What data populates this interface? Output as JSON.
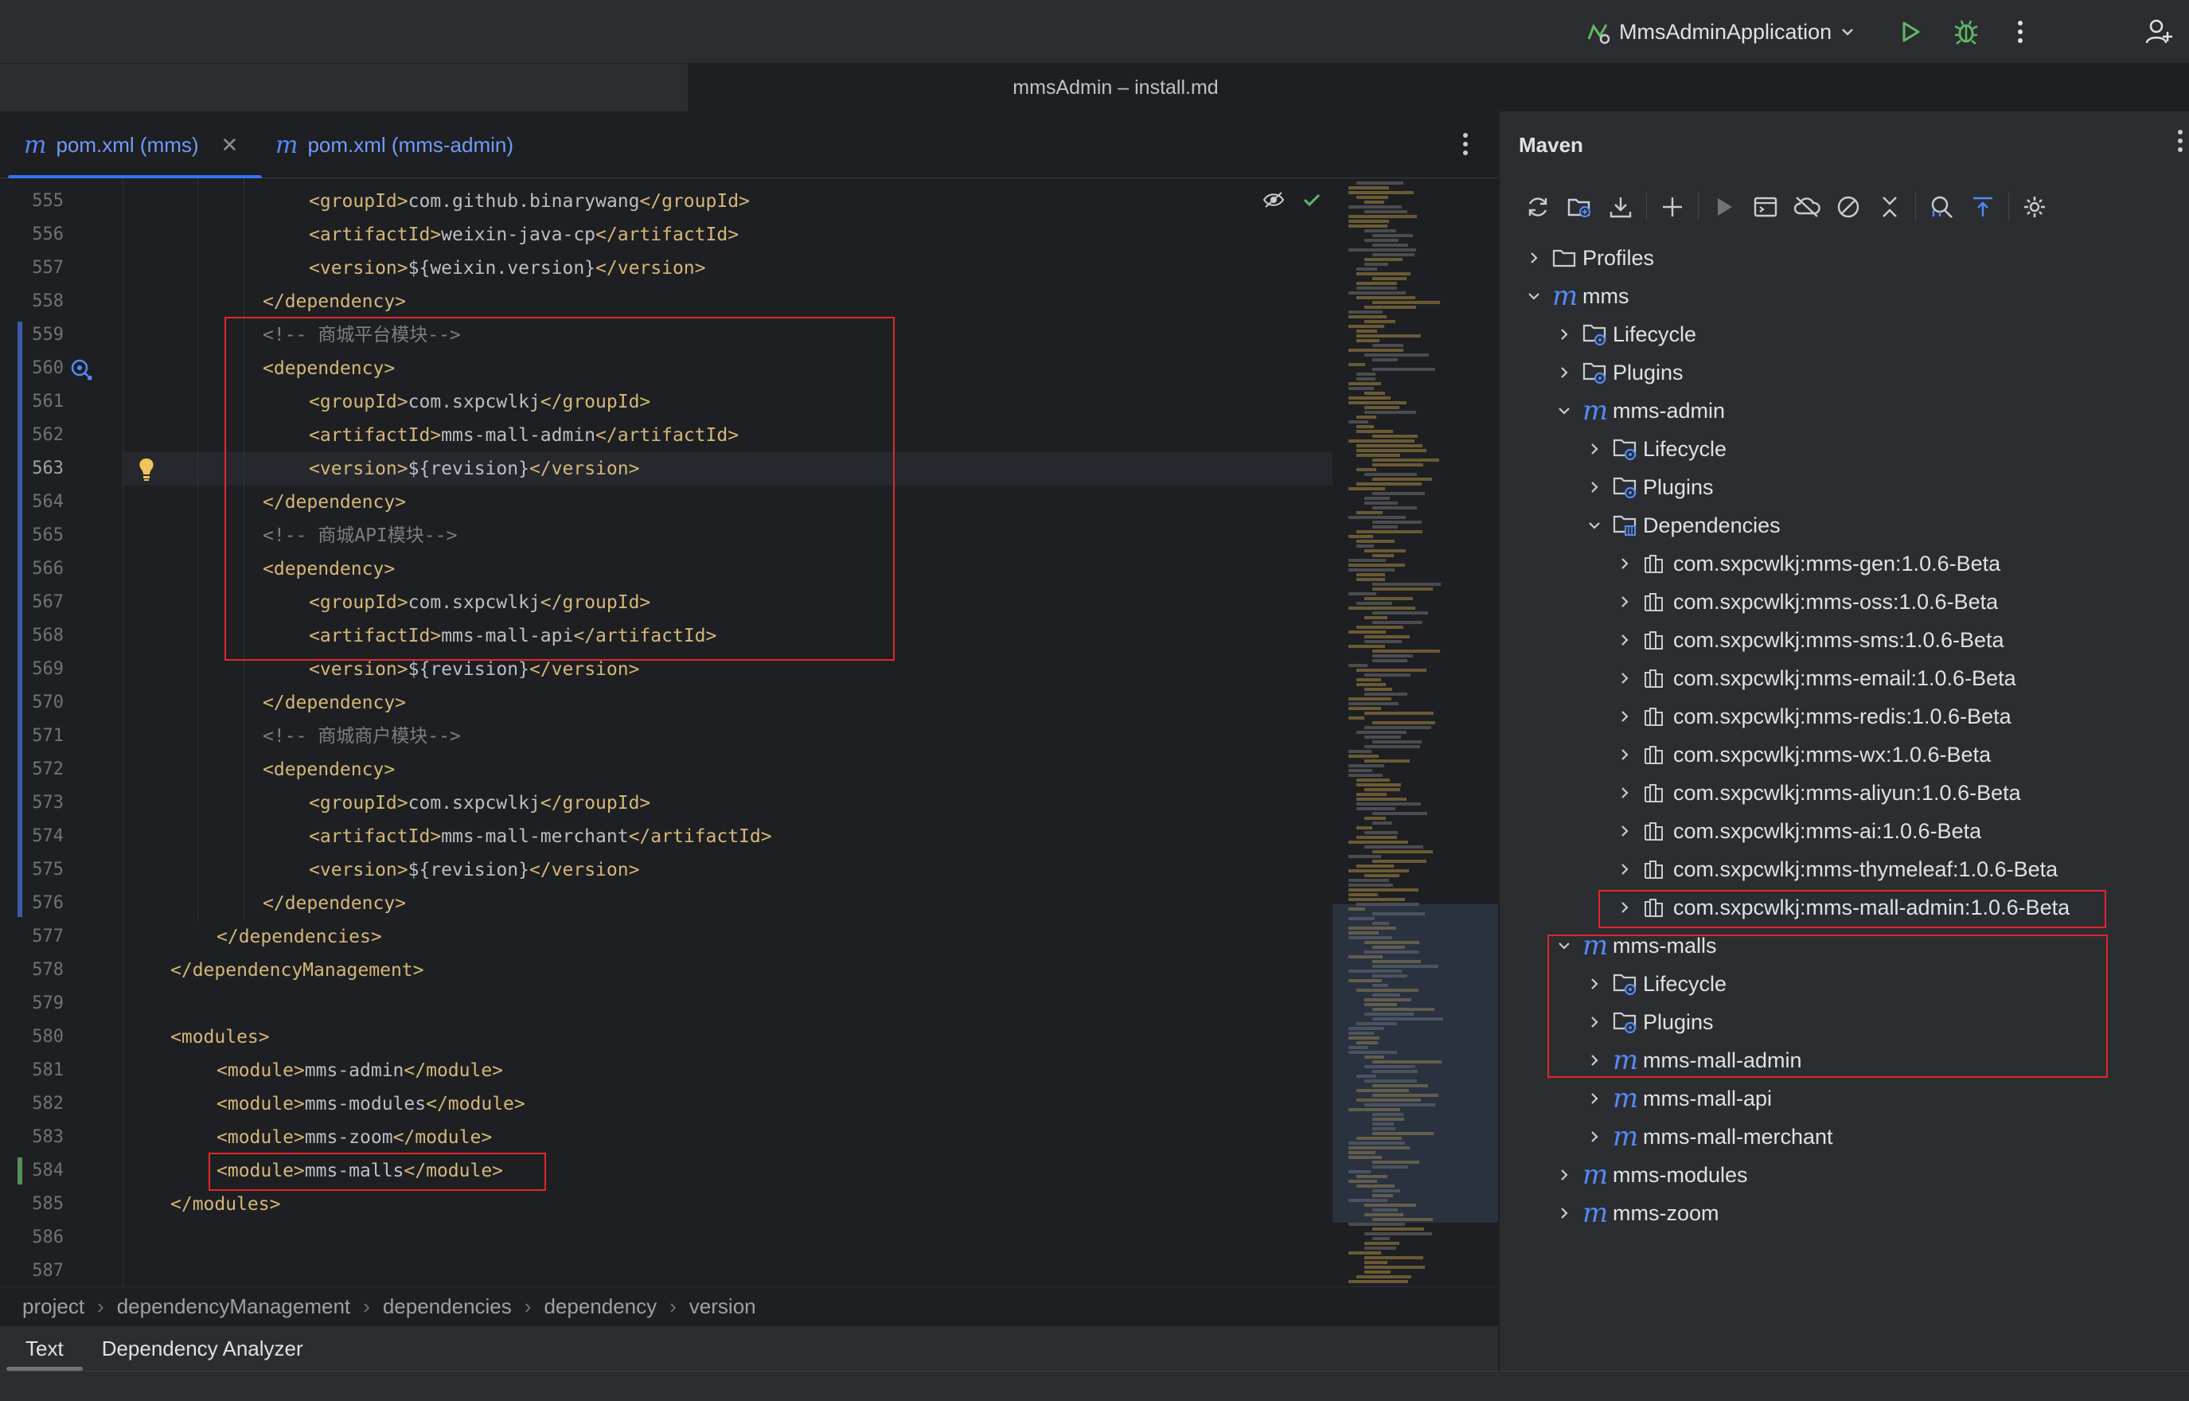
{
  "toolbar": {
    "run_config": "MmsAdminApplication",
    "icons": [
      "run-config-icon",
      "chevron-down-icon",
      "run-icon",
      "debug-icon",
      "more-vertical-icon",
      "add-user-icon"
    ]
  },
  "window_title": "mmsAdmin – install.md",
  "editor_tabs": [
    {
      "label": "pom.xml (mms)",
      "active": true,
      "closable": true
    },
    {
      "label": "pom.xml (mms-admin)",
      "active": false,
      "closable": false
    }
  ],
  "editor": {
    "current_line": 563,
    "lines": [
      {
        "n": 555,
        "indent": 3,
        "parts": [
          [
            "tag",
            "<groupId>"
          ],
          [
            "txt",
            "com.github.binarywang"
          ],
          [
            "tag",
            "</groupId>"
          ]
        ]
      },
      {
        "n": 556,
        "indent": 3,
        "parts": [
          [
            "tag",
            "<artifactId>"
          ],
          [
            "txt",
            "weixin-java-cp"
          ],
          [
            "tag",
            "</artifactId>"
          ]
        ]
      },
      {
        "n": 557,
        "indent": 3,
        "parts": [
          [
            "tag",
            "<version>"
          ],
          [
            "txt",
            "${weixin.version}"
          ],
          [
            "tag",
            "</version>"
          ]
        ]
      },
      {
        "n": 558,
        "indent": 2,
        "parts": [
          [
            "tag",
            "</dependency>"
          ]
        ]
      },
      {
        "n": 559,
        "indent": 2,
        "parts": [
          [
            "cmt",
            "<!-- 商城平台模块-->"
          ]
        ]
      },
      {
        "n": 560,
        "indent": 2,
        "parts": [
          [
            "tag",
            "<dependency>"
          ]
        ]
      },
      {
        "n": 561,
        "indent": 3,
        "parts": [
          [
            "tag",
            "<groupId>"
          ],
          [
            "txt",
            "com.sxpcwlkj"
          ],
          [
            "tag",
            "</groupId>"
          ]
        ]
      },
      {
        "n": 562,
        "indent": 3,
        "parts": [
          [
            "tag",
            "<artifactId>"
          ],
          [
            "txt",
            "mms-mall-admin"
          ],
          [
            "tag",
            "</artifactId>"
          ]
        ]
      },
      {
        "n": 563,
        "indent": 3,
        "parts": [
          [
            "tag",
            "<version>"
          ],
          [
            "txt",
            "${revision}"
          ],
          [
            "tag",
            "</version>"
          ]
        ]
      },
      {
        "n": 564,
        "indent": 2,
        "parts": [
          [
            "tag",
            "</dependency>"
          ]
        ]
      },
      {
        "n": 565,
        "indent": 2,
        "parts": [
          [
            "cmt",
            "<!-- 商城API模块-->"
          ]
        ]
      },
      {
        "n": 566,
        "indent": 2,
        "parts": [
          [
            "tag",
            "<dependency>"
          ]
        ]
      },
      {
        "n": 567,
        "indent": 3,
        "parts": [
          [
            "tag",
            "<groupId>"
          ],
          [
            "txt",
            "com.sxpcwlkj"
          ],
          [
            "tag",
            "</groupId>"
          ]
        ]
      },
      {
        "n": 568,
        "indent": 3,
        "parts": [
          [
            "tag",
            "<artifactId>"
          ],
          [
            "txt",
            "mms-mall-api"
          ],
          [
            "tag",
            "</artifactId>"
          ]
        ]
      },
      {
        "n": 569,
        "indent": 3,
        "parts": [
          [
            "tag",
            "<version>"
          ],
          [
            "txt",
            "${revision}"
          ],
          [
            "tag",
            "</version>"
          ]
        ]
      },
      {
        "n": 570,
        "indent": 2,
        "parts": [
          [
            "tag",
            "</dependency>"
          ]
        ]
      },
      {
        "n": 571,
        "indent": 2,
        "parts": [
          [
            "cmt",
            "<!-- 商城商户模块-->"
          ]
        ]
      },
      {
        "n": 572,
        "indent": 2,
        "parts": [
          [
            "tag",
            "<dependency>"
          ]
        ]
      },
      {
        "n": 573,
        "indent": 3,
        "parts": [
          [
            "tag",
            "<groupId>"
          ],
          [
            "txt",
            "com.sxpcwlkj"
          ],
          [
            "tag",
            "</groupId>"
          ]
        ]
      },
      {
        "n": 574,
        "indent": 3,
        "parts": [
          [
            "tag",
            "<artifactId>"
          ],
          [
            "txt",
            "mms-mall-merchant"
          ],
          [
            "tag",
            "</artifactId>"
          ]
        ]
      },
      {
        "n": 575,
        "indent": 3,
        "parts": [
          [
            "tag",
            "<version>"
          ],
          [
            "txt",
            "${revision}"
          ],
          [
            "tag",
            "</version>"
          ]
        ]
      },
      {
        "n": 576,
        "indent": 2,
        "parts": [
          [
            "tag",
            "</dependency>"
          ]
        ]
      },
      {
        "n": 577,
        "indent": 1,
        "parts": [
          [
            "tag",
            "</dependencies>"
          ]
        ]
      },
      {
        "n": 578,
        "indent": 0,
        "parts": [
          [
            "tag",
            "</dependencyManagement>"
          ]
        ]
      },
      {
        "n": 579,
        "indent": 0,
        "parts": []
      },
      {
        "n": 580,
        "indent": 0,
        "parts": [
          [
            "tag",
            "<modules>"
          ]
        ]
      },
      {
        "n": 581,
        "indent": 1,
        "parts": [
          [
            "tag",
            "<module>"
          ],
          [
            "txt",
            "mms-admin"
          ],
          [
            "tag",
            "</module>"
          ]
        ]
      },
      {
        "n": 582,
        "indent": 1,
        "parts": [
          [
            "tag",
            "<module>"
          ],
          [
            "txt",
            "mms-modules"
          ],
          [
            "tag",
            "</module>"
          ]
        ]
      },
      {
        "n": 583,
        "indent": 1,
        "parts": [
          [
            "tag",
            "<module>"
          ],
          [
            "txt",
            "mms-zoom"
          ],
          [
            "tag",
            "</module>"
          ]
        ]
      },
      {
        "n": 584,
        "indent": 1,
        "parts": [
          [
            "tag",
            "<module>"
          ],
          [
            "txt",
            "mms-malls"
          ],
          [
            "tag",
            "</module>"
          ]
        ]
      },
      {
        "n": 585,
        "indent": 0,
        "parts": [
          [
            "tag",
            "</modules>"
          ]
        ]
      },
      {
        "n": 586,
        "indent": 0,
        "parts": []
      },
      {
        "n": 587,
        "indent": 0,
        "parts": []
      }
    ]
  },
  "breadcrumb": [
    "project",
    "dependencyManagement",
    "dependencies",
    "dependency",
    "version"
  ],
  "bottom_tabs": [
    {
      "label": "Text",
      "active": true
    },
    {
      "label": "Dependency Analyzer",
      "active": false
    }
  ],
  "maven": {
    "title": "Maven",
    "toolbar_icons": [
      "reload-icon",
      "add-folder-icon",
      "download-icon",
      "plus-icon",
      "run-icon",
      "execute-goal-icon",
      "offline-icon",
      "skip-tests-icon",
      "collapse-icon",
      "analyze-icon",
      "expand-icon",
      "settings-icon"
    ],
    "tree": [
      {
        "level": 0,
        "expanded": false,
        "icon": "folder-icon",
        "label": "Profiles"
      },
      {
        "level": 0,
        "expanded": true,
        "icon": "maven-module-icon",
        "label": "mms"
      },
      {
        "level": 1,
        "expanded": false,
        "icon": "lifecycle-folder-icon",
        "label": "Lifecycle"
      },
      {
        "level": 1,
        "expanded": false,
        "icon": "plugins-folder-icon",
        "label": "Plugins"
      },
      {
        "level": 1,
        "expanded": true,
        "icon": "maven-module-icon",
        "label": "mms-admin"
      },
      {
        "level": 2,
        "expanded": false,
        "icon": "lifecycle-folder-icon",
        "label": "Lifecycle"
      },
      {
        "level": 2,
        "expanded": false,
        "icon": "plugins-folder-icon",
        "label": "Plugins"
      },
      {
        "level": 2,
        "expanded": true,
        "icon": "dependencies-folder-icon",
        "label": "Dependencies"
      },
      {
        "level": 3,
        "expanded": false,
        "icon": "library-icon",
        "label": "com.sxpcwlkj:mms-gen:1.0.6-Beta"
      },
      {
        "level": 3,
        "expanded": false,
        "icon": "library-icon",
        "label": "com.sxpcwlkj:mms-oss:1.0.6-Beta"
      },
      {
        "level": 3,
        "expanded": false,
        "icon": "library-icon",
        "label": "com.sxpcwlkj:mms-sms:1.0.6-Beta"
      },
      {
        "level": 3,
        "expanded": false,
        "icon": "library-icon",
        "label": "com.sxpcwlkj:mms-email:1.0.6-Beta"
      },
      {
        "level": 3,
        "expanded": false,
        "icon": "library-icon",
        "label": "com.sxpcwlkj:mms-redis:1.0.6-Beta"
      },
      {
        "level": 3,
        "expanded": false,
        "icon": "library-icon",
        "label": "com.sxpcwlkj:mms-wx:1.0.6-Beta"
      },
      {
        "level": 3,
        "expanded": false,
        "icon": "library-icon",
        "label": "com.sxpcwlkj:mms-aliyun:1.0.6-Beta"
      },
      {
        "level": 3,
        "expanded": false,
        "icon": "library-icon",
        "label": "com.sxpcwlkj:mms-ai:1.0.6-Beta"
      },
      {
        "level": 3,
        "expanded": false,
        "icon": "library-icon",
        "label": "com.sxpcwlkj:mms-thymeleaf:1.0.6-Beta"
      },
      {
        "level": 3,
        "expanded": false,
        "icon": "library-icon",
        "label": "com.sxpcwlkj:mms-mall-admin:1.0.6-Beta"
      },
      {
        "level": 1,
        "expanded": true,
        "icon": "maven-module-icon",
        "label": "mms-malls"
      },
      {
        "level": 2,
        "expanded": false,
        "icon": "lifecycle-folder-icon",
        "label": "Lifecycle"
      },
      {
        "level": 2,
        "expanded": false,
        "icon": "plugins-folder-icon",
        "label": "Plugins"
      },
      {
        "level": 2,
        "expanded": false,
        "icon": "maven-module-icon",
        "label": "mms-mall-admin"
      },
      {
        "level": 2,
        "expanded": false,
        "icon": "maven-module-icon",
        "label": "mms-mall-api"
      },
      {
        "level": 2,
        "expanded": false,
        "icon": "maven-module-icon",
        "label": "mms-mall-merchant"
      },
      {
        "level": 1,
        "expanded": false,
        "icon": "maven-module-icon",
        "label": "mms-modules"
      },
      {
        "level": 1,
        "expanded": false,
        "icon": "maven-module-icon",
        "label": "mms-zoom"
      }
    ]
  },
  "colors": {
    "annotation_box": "#e0262d",
    "xml_tag": "#d5b778",
    "comment": "#7a7e85",
    "maven_icon": "#548af7"
  }
}
